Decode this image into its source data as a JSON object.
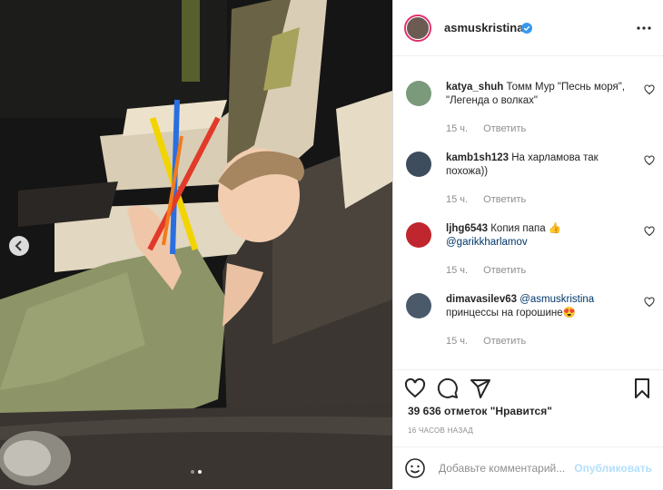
{
  "header": {
    "username": "asmuskristina",
    "verified_icon": "verified-badge-icon",
    "more_icon": "more-dots-icon"
  },
  "photo": {
    "prev_icon": "chevron-left-icon",
    "carousel_active_index": 2,
    "carousel_total": 2
  },
  "comments": [
    {
      "user": "katya_shuh",
      "text": "Томм Мур \"Песнь моря\", \"Легенда о волках\"",
      "time": "15 ч.",
      "reply": "Ответить"
    },
    {
      "user": "kamb1sh123",
      "text": "На харламова так похожа))",
      "time": "15 ч.",
      "reply": "Ответить"
    },
    {
      "user": "ljhg6543",
      "text": "Копия папа 👍",
      "mention": "@garikkharlamov",
      "time": "15 ч.",
      "reply": "Ответить"
    },
    {
      "user": "dimavasilev63",
      "mention": "@asmuskristina",
      "text": "принцессы на горошине😍",
      "time": "15 ч.",
      "reply": "Ответить"
    }
  ],
  "actions": {
    "like_icon": "heart-icon",
    "comment_icon": "comment-icon",
    "share_icon": "paper-plane-icon",
    "save_icon": "bookmark-icon",
    "likes": "39 636 отметок \"Нравится\"",
    "posted_ago": "16 ЧАСОВ НАЗАД"
  },
  "add_comment": {
    "emoji_icon": "smiley-icon",
    "placeholder": "Добавьте комментарий...",
    "publish": "Опубликовать"
  },
  "colors": {
    "link": "#00376b",
    "publish": "#b2dffc",
    "verified": "#3897f0"
  }
}
